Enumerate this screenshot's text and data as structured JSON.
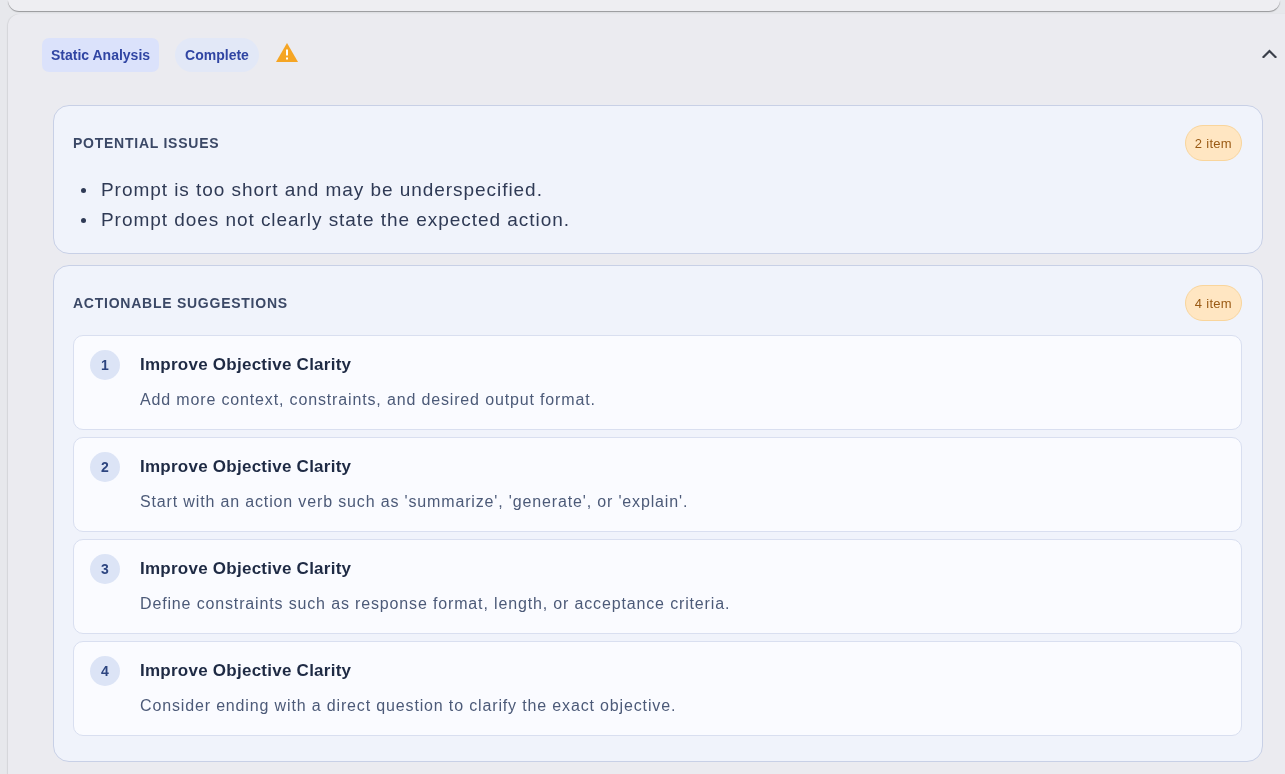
{
  "header": {
    "tags": [
      {
        "label": "Static Analysis",
        "kind": "type"
      },
      {
        "label": "Complete",
        "kind": "status"
      }
    ],
    "warning": true,
    "expanded": true
  },
  "issues": {
    "title": "POTENTIAL ISSUES",
    "count": "2 item",
    "items": [
      "Prompt is too short and may be underspecified.",
      "Prompt does not clearly state the expected action."
    ]
  },
  "suggestions": {
    "title": "ACTIONABLE SUGGESTIONS",
    "count": "4 item",
    "items": [
      {
        "number": "1",
        "title": "Improve Objective Clarity",
        "description": "Add more context, constraints, and desired output format."
      },
      {
        "number": "2",
        "title": "Improve Objective Clarity",
        "description": "Start with an action verb such as 'summarize', 'generate', or 'explain'."
      },
      {
        "number": "3",
        "title": "Improve Objective Clarity",
        "description": "Define constraints such as response format, length, or acceptance criteria."
      },
      {
        "number": "4",
        "title": "Improve Objective Clarity",
        "description": "Consider ending with a direct question to clarify the exact objective."
      }
    ]
  }
}
